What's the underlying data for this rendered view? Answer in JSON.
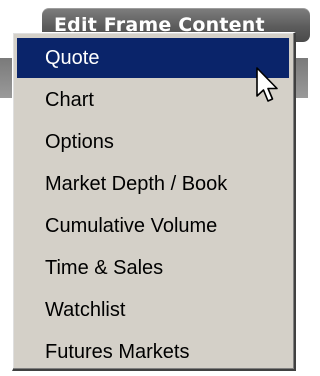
{
  "header": {
    "title": "Edit Frame Content"
  },
  "menu": {
    "items": [
      {
        "label": "Quote",
        "selected": true
      },
      {
        "label": "Chart",
        "selected": false
      },
      {
        "label": "Options",
        "selected": false
      },
      {
        "label": "Market Depth / Book",
        "selected": false
      },
      {
        "label": "Cumulative Volume",
        "selected": false
      },
      {
        "label": "Time & Sales",
        "selected": false
      },
      {
        "label": "Watchlist",
        "selected": false
      },
      {
        "label": "Futures Markets",
        "selected": false
      }
    ]
  },
  "colors": {
    "menu_background": "#d4d0c8",
    "selection": "#0a246a",
    "header_button": "#5c5c5c"
  },
  "icons": {
    "cursor": "arrow-pointer-icon"
  }
}
